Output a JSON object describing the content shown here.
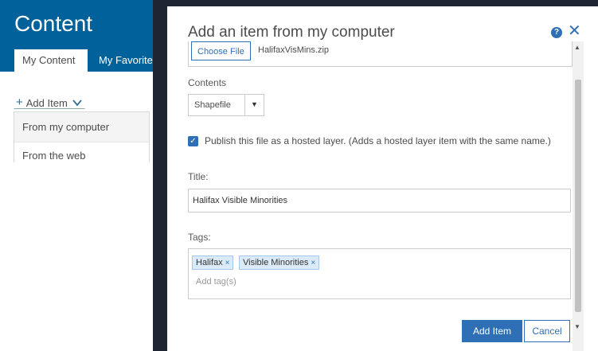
{
  "background": {
    "page_title": "Content",
    "tabs": [
      {
        "label": "My Content"
      },
      {
        "label": "My Favorites"
      }
    ],
    "add_item": {
      "label": "Add Item",
      "menu": [
        {
          "label": "From my computer"
        },
        {
          "label": "From the web"
        }
      ]
    }
  },
  "dialog": {
    "title": "Add an item from my computer",
    "help_icon": "?",
    "close_icon": "✕",
    "file": {
      "button_label": "Choose File",
      "file_name": "HalifaxVisMins.zip"
    },
    "contents": {
      "label": "Contents",
      "selected": "Shapefile",
      "arrow": "▼"
    },
    "publish": {
      "checked": true,
      "check_glyph": "✓",
      "text": "Publish this file as a hosted layer. (Adds a hosted layer item with the same name.)"
    },
    "title_field": {
      "label": "Title:",
      "value": "Halifax Visible Minorities"
    },
    "tags_field": {
      "label": "Tags:",
      "tags": [
        {
          "label": "Halifax",
          "remove": "×"
        },
        {
          "label": "Visible Minorities",
          "remove": "×"
        }
      ],
      "placeholder": "Add tag(s)"
    },
    "buttons": {
      "add": "Add Item",
      "cancel": "Cancel"
    },
    "scrollbar": {
      "up": "▲",
      "down": "▼"
    }
  },
  "colors": {
    "accent": "#2e6fb5",
    "hero": "#00619b",
    "overlay": "#1f2633"
  }
}
